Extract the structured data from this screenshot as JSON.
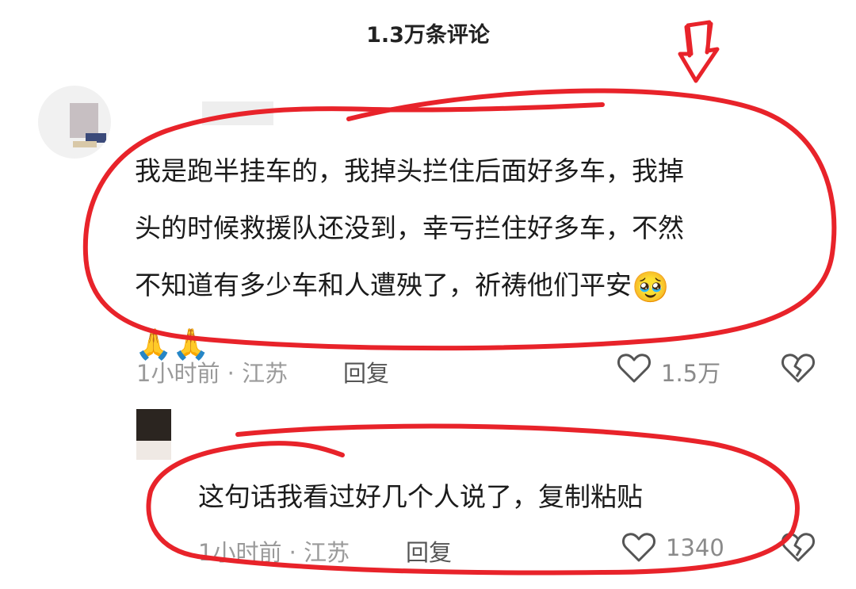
{
  "header": {
    "title": "1.3万条评论"
  },
  "comments": [
    {
      "text_lines": [
        "我是跑半挂车的，我掉头拦住后面好多车，我掉",
        "头的时候救援队还没到，幸亏拦住好多车，不然",
        "不知道有多少车和人遭殃了，祈祷他们平安"
      ],
      "emoji_inline": "🥹",
      "emoji_line": "🙏🙏",
      "meta": "1小时前 · 江苏",
      "reply_label": "回复",
      "likes": "1.5万"
    },
    {
      "text": "这句话我看过好几个人说了，复制粘贴",
      "meta": "1小时前 · 江苏",
      "reply_label": "回复",
      "likes": "1340"
    }
  ],
  "icons": {
    "like": "heart-outline-icon",
    "dislike": "broken-heart-icon",
    "arrow": "down-arrow-annotation-icon"
  },
  "colors": {
    "annotation": "#e8232a",
    "meta_text": "#9a9a9a",
    "body_text": "#1b1b1b"
  }
}
